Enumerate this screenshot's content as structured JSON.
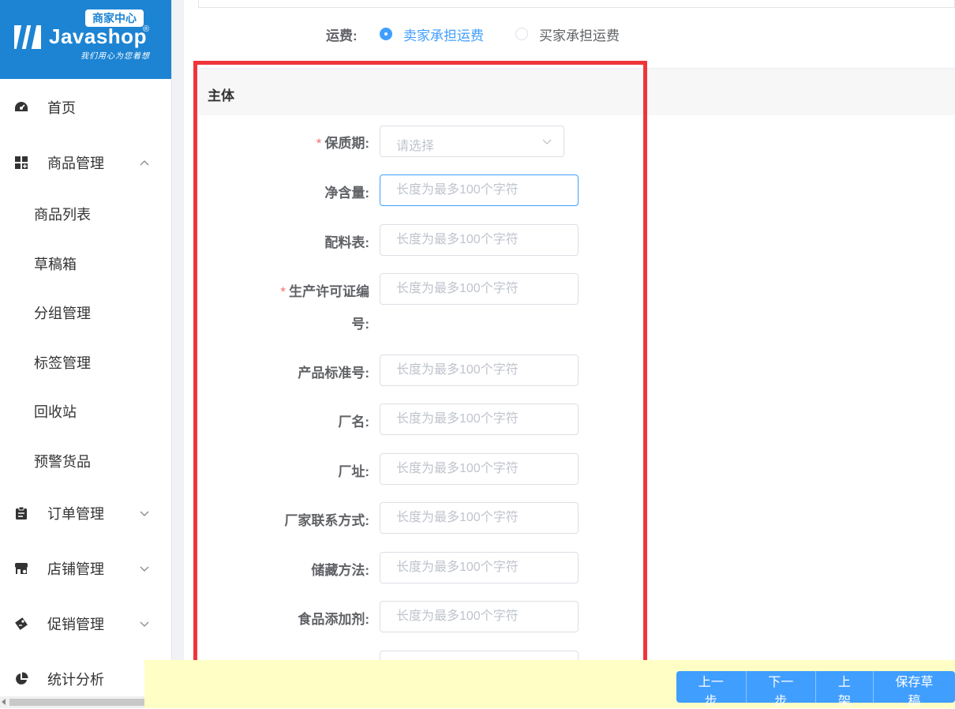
{
  "brand": {
    "badge": "商家中心",
    "name": "Javashop",
    "registered": "®",
    "slogan": "我们用心为您着想"
  },
  "sidebar": {
    "items": [
      {
        "label": "首页",
        "icon": "dashboard-icon"
      },
      {
        "label": "商品管理",
        "icon": "goods-icon",
        "expanded": true,
        "children": [
          {
            "label": "商品列表"
          },
          {
            "label": "草稿箱"
          },
          {
            "label": "分组管理"
          },
          {
            "label": "标签管理"
          },
          {
            "label": "回收站"
          },
          {
            "label": "预警货品"
          }
        ]
      },
      {
        "label": "订单管理",
        "icon": "order-icon"
      },
      {
        "label": "店铺管理",
        "icon": "shop-icon"
      },
      {
        "label": "促销管理",
        "icon": "promotion-icon"
      },
      {
        "label": "统计分析",
        "icon": "statistics-icon"
      }
    ]
  },
  "freight": {
    "label": "运费:",
    "options": [
      {
        "label": "卖家承担运费",
        "checked": true
      },
      {
        "label": "买家承担运费",
        "checked": false
      }
    ]
  },
  "section": {
    "title": "主体"
  },
  "form": {
    "shelf_life": {
      "label": "保质期:",
      "required": true,
      "placeholder": "请选择"
    },
    "placeholder": "长度为最多100个字符",
    "fields": [
      {
        "label": "净含量:",
        "required": false
      },
      {
        "label": "配料表:",
        "required": false
      },
      {
        "label_line1": "生产许可证编",
        "label_line2": "号:",
        "required": true
      },
      {
        "label": "产品标准号:",
        "required": false
      },
      {
        "label": "厂名:",
        "required": false
      },
      {
        "label": "厂址:",
        "required": false
      },
      {
        "label": "厂家联系方式:",
        "required": false
      },
      {
        "label": "储藏方法:",
        "required": false
      },
      {
        "label": "食品添加剂:",
        "required": false
      }
    ]
  },
  "actions": {
    "prev": "上一步",
    "next": "下一步",
    "publish": "上架",
    "save_draft": "保存草稿"
  },
  "colors": {
    "brand_blue": "#1d84d3",
    "primary": "#409eff",
    "required": "#f56c6c",
    "highlight": "#f0353a",
    "bottom_bar": "#ffffc5"
  }
}
